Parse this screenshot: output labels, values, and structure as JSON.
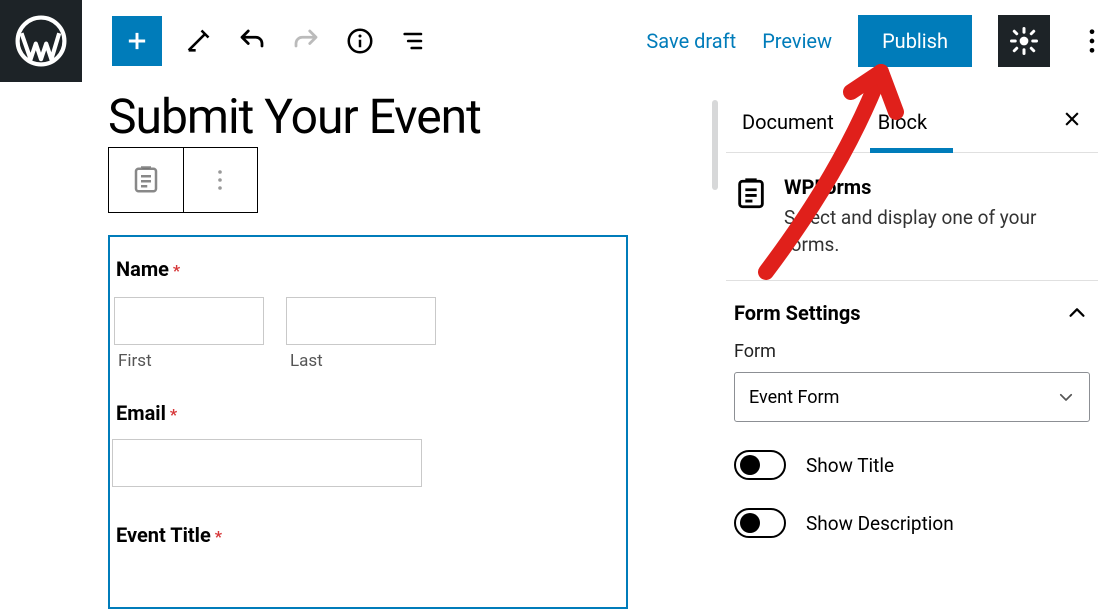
{
  "header": {
    "save_draft": "Save draft",
    "preview": "Preview",
    "publish": "Publish"
  },
  "editor": {
    "page_title": "Submit Your Event",
    "fields": {
      "name_label": "Name",
      "first_sub": "First",
      "last_sub": "Last",
      "email_label": "Email",
      "event_title_label": "Event Title"
    }
  },
  "sidebar": {
    "tabs": {
      "document": "Document",
      "block": "Block"
    },
    "block_info": {
      "title": "WPForms",
      "desc": "Select and display one of your forms."
    },
    "settings_head": "Form Settings",
    "form_label": "Form",
    "form_selected": "Event Form",
    "toggle1": "Show Title",
    "toggle2": "Show Description"
  }
}
